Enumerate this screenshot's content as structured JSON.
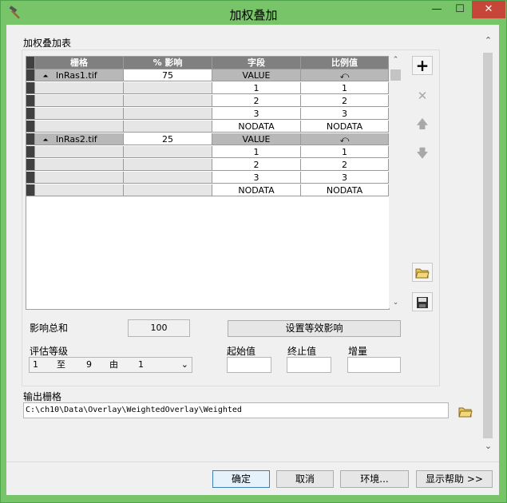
{
  "window": {
    "title": "加权叠加",
    "minimize": "—",
    "maximize": "☐",
    "close": "✕"
  },
  "table_label": "加权叠加表",
  "grid": {
    "headers": [
      "栅格",
      "% 影响",
      "字段",
      "比例值"
    ],
    "groups": [
      {
        "raster": "lnRas1.tif",
        "influence": "75",
        "field": "VALUE",
        "scale_icon": "undo-arrow-icon",
        "rows": [
          {
            "field": "1",
            "scale": "1"
          },
          {
            "field": "2",
            "scale": "2"
          },
          {
            "field": "3",
            "scale": "3"
          },
          {
            "field": "NODATA",
            "scale": "NODATA"
          }
        ]
      },
      {
        "raster": "lnRas2.tif",
        "influence": "25",
        "field": "VALUE",
        "scale_icon": "undo-arrow-icon",
        "rows": [
          {
            "field": "1",
            "scale": "1"
          },
          {
            "field": "2",
            "scale": "2"
          },
          {
            "field": "3",
            "scale": "3"
          },
          {
            "field": "NODATA",
            "scale": "NODATA"
          }
        ]
      }
    ]
  },
  "side_buttons": {
    "add": "+",
    "remove": "✕",
    "up": "🡅",
    "down": "🡇"
  },
  "influence_total": {
    "label": "影响总和",
    "value": "100"
  },
  "set_equal_button": "设置等效影响",
  "eval_scale": {
    "label": "评估等级",
    "from": "1",
    "to_word": "至",
    "to": "9",
    "by_word": "由",
    "by": "1"
  },
  "range": {
    "start_label": "起始值",
    "end_label": "终止值",
    "increment_label": "增量",
    "start": "",
    "end": "",
    "increment": ""
  },
  "output": {
    "label": "输出栅格",
    "value": "C:\\ch10\\Data\\Overlay\\WeightedOverlay\\Weighted"
  },
  "footer": {
    "ok": "确定",
    "cancel": "取消",
    "env": "环境...",
    "help": "显示帮助 >>"
  },
  "colors": {
    "title_bar": "#78c468",
    "close_button": "#c7463a",
    "grid_header": "#808080",
    "default_button_border": "#3c7fb1"
  }
}
